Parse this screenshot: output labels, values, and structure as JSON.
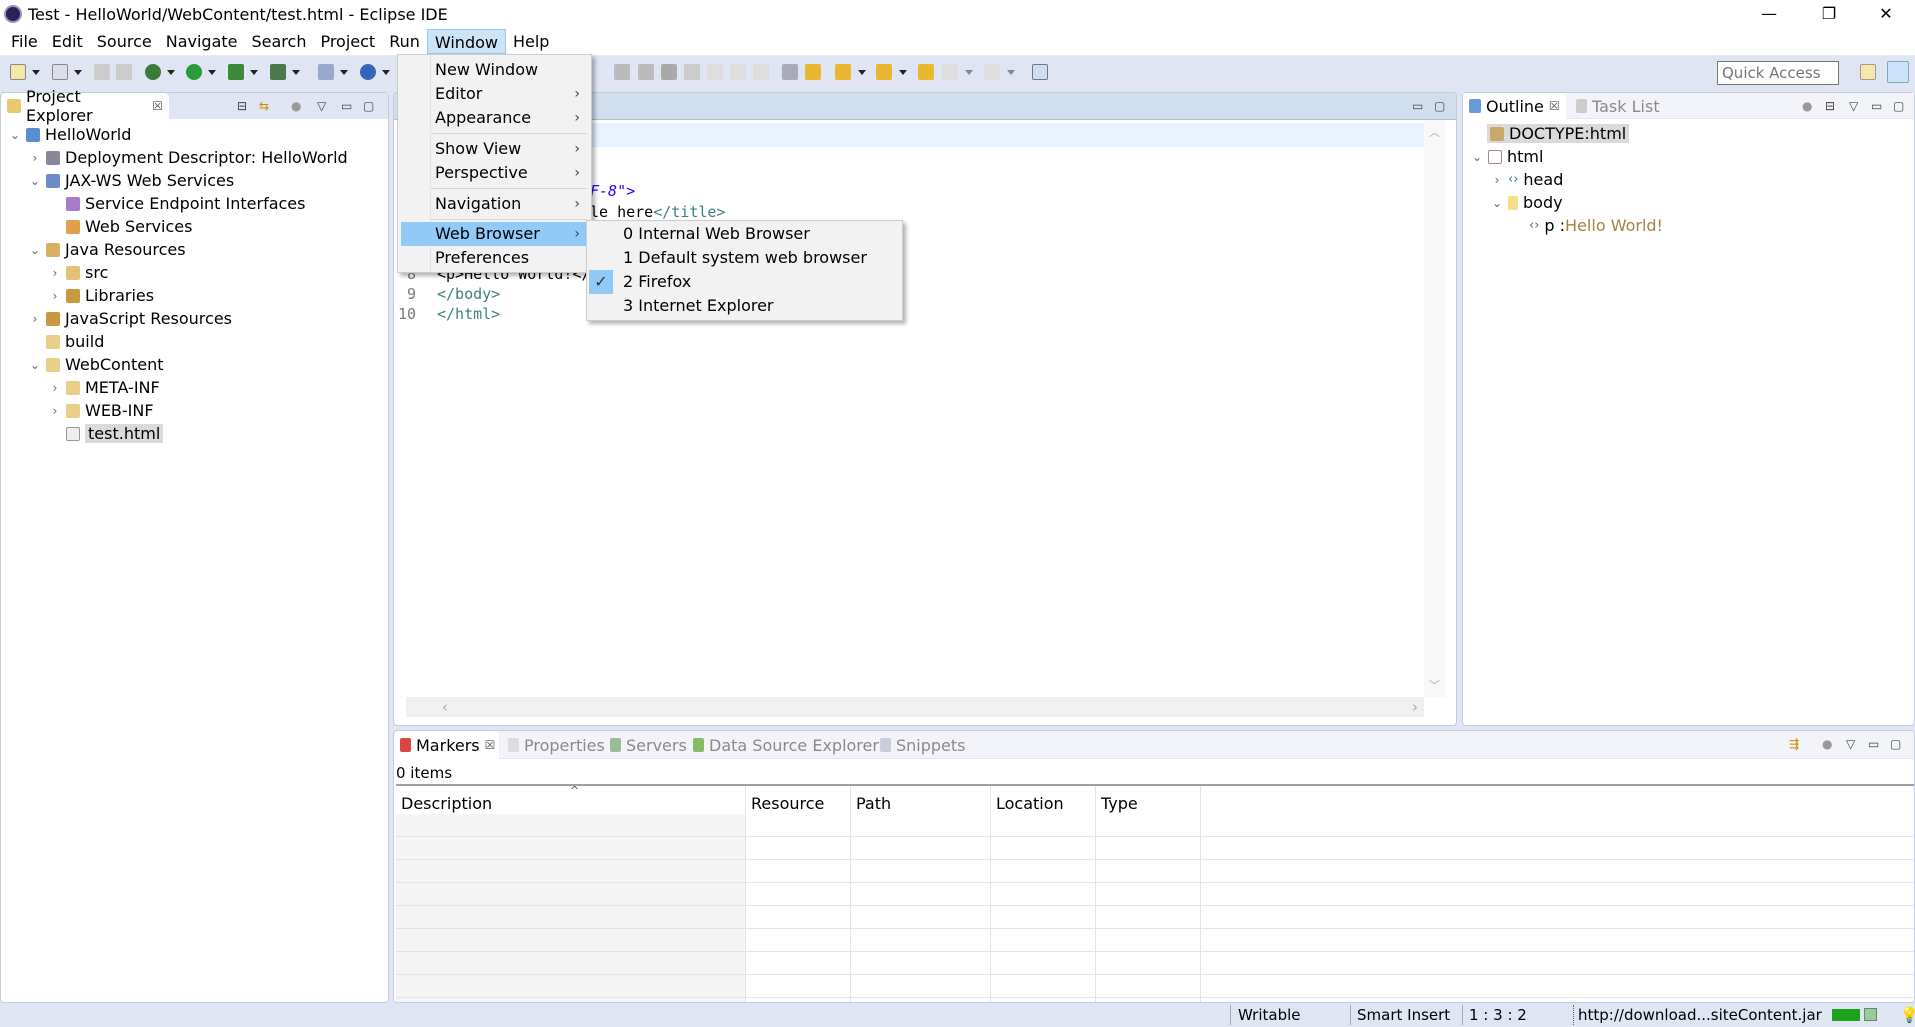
{
  "window": {
    "title": "Test - HelloWorld/WebContent/test.html - Eclipse IDE",
    "minimize": "—",
    "restore": "❐",
    "close": "✕"
  },
  "menubar": [
    "File",
    "Edit",
    "Source",
    "Navigate",
    "Search",
    "Project",
    "Run",
    "Window",
    "Help"
  ],
  "quick_access": {
    "placeholder": "Quick Access"
  },
  "project_explorer": {
    "title": "Project Explorer",
    "items": [
      {
        "label": "HelloWorld",
        "level": 0,
        "twisty": "open",
        "icon": "project-icon"
      },
      {
        "label": "Deployment Descriptor: HelloWorld",
        "level": 1,
        "twisty": "closed",
        "icon": "deployment-descriptor-icon"
      },
      {
        "label": "JAX-WS Web Services",
        "level": 1,
        "twisty": "open",
        "icon": "web-services-icon"
      },
      {
        "label": "Service Endpoint Interfaces",
        "level": 2,
        "twisty": "none",
        "icon": "endpoint-icon"
      },
      {
        "label": "Web Services",
        "level": 2,
        "twisty": "none",
        "icon": "web-service-icon"
      },
      {
        "label": "Java Resources",
        "level": 1,
        "twisty": "open",
        "icon": "java-resources-icon"
      },
      {
        "label": "src",
        "level": 2,
        "twisty": "closed",
        "icon": "package-folder-icon"
      },
      {
        "label": "Libraries",
        "level": 2,
        "twisty": "closed",
        "icon": "libraries-icon"
      },
      {
        "label": "JavaScript Resources",
        "level": 1,
        "twisty": "closed",
        "icon": "libraries-icon"
      },
      {
        "label": "build",
        "level": 1,
        "twisty": "none",
        "icon": "folder-icon"
      },
      {
        "label": "WebContent",
        "level": 1,
        "twisty": "open",
        "icon": "folder-open-icon"
      },
      {
        "label": "META-INF",
        "level": 2,
        "twisty": "closed",
        "icon": "folder-icon"
      },
      {
        "label": "WEB-INF",
        "level": 2,
        "twisty": "closed",
        "icon": "folder-icon"
      },
      {
        "label": "test.html",
        "level": 2,
        "twisty": "none",
        "icon": "file-icon",
        "selected": true
      }
    ]
  },
  "editor": {
    "fragments": [
      {
        "line": "",
        "text": "F-8\">"
      },
      {
        "line": "",
        "text": "le here",
        "tag": "</title>"
      },
      {
        "line": "8",
        "text": "<p>Hello World!</"
      },
      {
        "line": "9",
        "text": "</body>"
      },
      {
        "line": "10",
        "text": "</html>"
      }
    ]
  },
  "window_menu": {
    "items": [
      {
        "label": "New Window",
        "submenu": false
      },
      {
        "label": "Editor",
        "submenu": true
      },
      {
        "label": "Appearance",
        "submenu": true
      },
      {
        "label": "Show View",
        "submenu": true
      },
      {
        "label": "Perspective",
        "submenu": true
      },
      {
        "label": "Navigation",
        "submenu": true
      },
      {
        "label": "Web Browser",
        "submenu": true,
        "highlighted": true
      },
      {
        "label": "Preferences",
        "submenu": false
      }
    ],
    "web_browser_submenu": [
      {
        "label": "0 Internal Web Browser",
        "checked": false
      },
      {
        "label": "1 Default system web browser",
        "checked": false
      },
      {
        "label": "2 Firefox",
        "checked": true
      },
      {
        "label": "3 Internet Explorer",
        "checked": false
      }
    ]
  },
  "outline": {
    "tabs": [
      "Outline",
      "Task List"
    ],
    "items": [
      {
        "label": "DOCTYPE:html",
        "level": 0,
        "selected": true
      },
      {
        "label": "html",
        "level": 0,
        "twisty": "open"
      },
      {
        "label": "head",
        "level": 1,
        "twisty": "closed"
      },
      {
        "label": "body",
        "level": 1,
        "twisty": "open"
      },
      {
        "label": "p : ",
        "value": "Hello World!",
        "level": 2
      }
    ]
  },
  "bottom": {
    "tabs": [
      "Markers",
      "Properties",
      "Servers",
      "Data Source Explorer",
      "Snippets"
    ],
    "count": "0 items",
    "columns": [
      "Description",
      "Resource",
      "Path",
      "Location",
      "Type"
    ],
    "sort_indicator": "^"
  },
  "status": {
    "writable": "Writable",
    "insert": "Smart Insert",
    "position": "1 : 3 : 2",
    "job": "http://download...siteContent.jar"
  },
  "colors": {
    "menu_highlight": "#91c9f7",
    "tag": "#3f7f7f",
    "string": "#2a00ff",
    "outline_value": "#a58247"
  }
}
